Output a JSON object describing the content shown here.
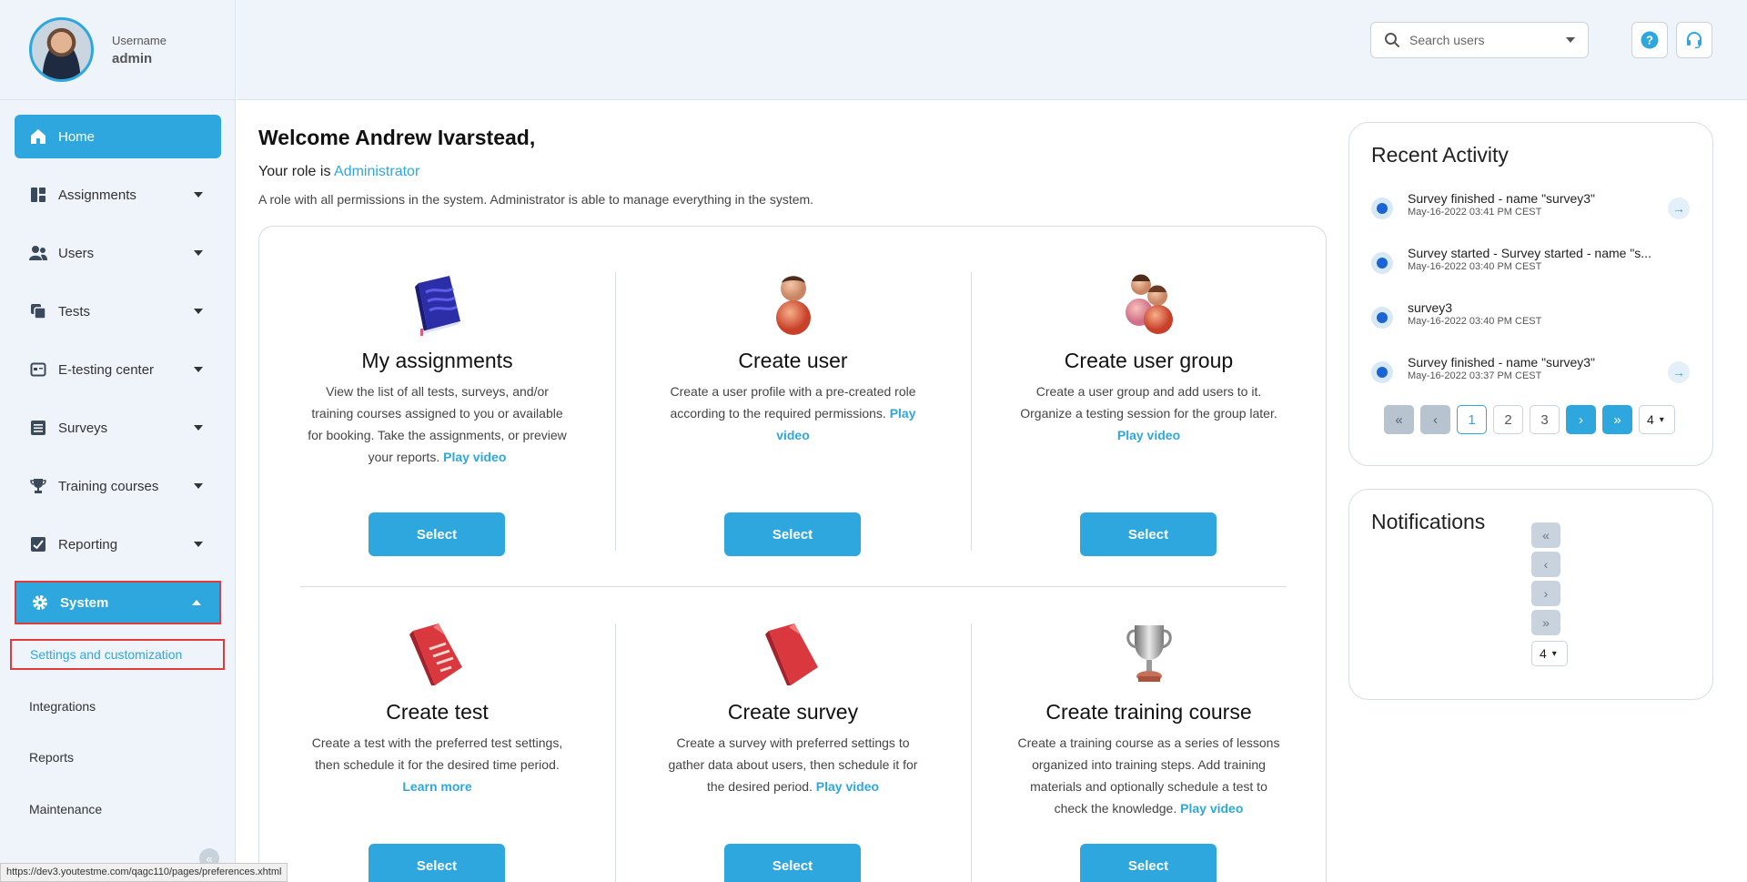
{
  "profile": {
    "username_label": "Username",
    "username": "admin"
  },
  "sidebar": {
    "items": [
      {
        "label": "Home",
        "icon": "home-icon"
      },
      {
        "label": "Assignments",
        "icon": "assignments-icon"
      },
      {
        "label": "Users",
        "icon": "users-icon"
      },
      {
        "label": "Tests",
        "icon": "tests-icon"
      },
      {
        "label": "E-testing center",
        "icon": "testing-center-icon"
      },
      {
        "label": "Surveys",
        "icon": "surveys-icon"
      },
      {
        "label": "Training courses",
        "icon": "trophy-icon"
      },
      {
        "label": "Reporting",
        "icon": "reporting-icon"
      },
      {
        "label": "System",
        "icon": "gear-icon"
      }
    ],
    "system_sub": [
      "Settings and customization",
      "Integrations",
      "Reports",
      "Maintenance"
    ],
    "collapse_glyph": "«"
  },
  "status_url": "https://dev3.youtestme.com/qagc110/pages/preferences.xhtml",
  "header": {
    "search_placeholder": "Search users"
  },
  "welcome": {
    "title": "Welcome Andrew Ivarstead,",
    "role_prefix": "Your role is",
    "role": "Administrator",
    "role_desc": "A role with all permissions in the system. Administrator is able to manage everything in the system."
  },
  "cards": [
    {
      "title": "My assignments",
      "desc": "View the list of all tests, surveys, and/or training courses assigned to you or available for booking. Take the assignments, or preview your reports.",
      "link": "Play video",
      "button": "Select"
    },
    {
      "title": "Create user",
      "desc": "Create a user profile with a pre-created role according to the required permissions.",
      "link": "Play video",
      "button": "Select"
    },
    {
      "title": "Create user group",
      "desc": "Create a user group and add users to it. Organize a testing session for the group later.",
      "link": "Play video",
      "button": "Select"
    },
    {
      "title": "Create test",
      "desc": "Create a test with the preferred test settings, then schedule it for the desired time period.",
      "link": "Learn more",
      "button": "Select"
    },
    {
      "title": "Create survey",
      "desc": "Create a survey with preferred settings to gather data about users, then schedule it for the desired period.",
      "link": "Play video",
      "button": "Select"
    },
    {
      "title": "Create training course",
      "desc": "Create a training course as a series of lessons organized into training steps. Add training materials and optionally schedule a test to check the knowledge.",
      "link": "Play video",
      "button": "Select"
    }
  ],
  "recent_activity": {
    "title": "Recent Activity",
    "items": [
      {
        "title": "Survey finished - name \"survey3\"",
        "date": "May-16-2022 03:41 PM CEST"
      },
      {
        "title": "Survey started - Survey started - name \"s...",
        "date": "May-16-2022 03:40 PM CEST"
      },
      {
        "title": "survey3",
        "date": "May-16-2022 03:40 PM CEST"
      },
      {
        "title": "Survey finished - name \"survey3\"",
        "date": "May-16-2022 03:37 PM CEST"
      }
    ],
    "pages": [
      "1",
      "2",
      "3"
    ],
    "page_size": "4"
  },
  "notifications": {
    "title": "Notifications",
    "page_size": "4"
  }
}
